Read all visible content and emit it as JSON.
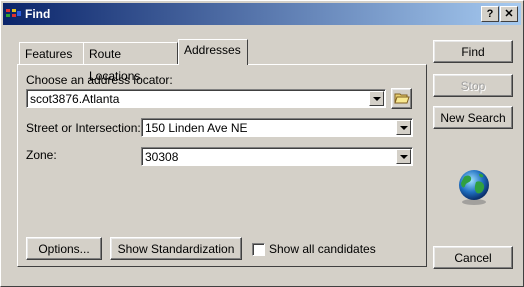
{
  "window": {
    "title": "Find",
    "help_label": "?",
    "close_label": "✕"
  },
  "tabs": [
    {
      "label": "Features"
    },
    {
      "label": "Route Locations"
    },
    {
      "label": "Addresses"
    }
  ],
  "address_locator": {
    "label": "Choose an address locator:",
    "value": "scot3876.Atlanta"
  },
  "street": {
    "label": "Street or Intersection:",
    "value": "150 Linden Ave NE"
  },
  "zone": {
    "label": "Zone:",
    "value": "30308"
  },
  "buttons": {
    "find": "Find",
    "stop": "Stop",
    "new_search": "New Search",
    "cancel": "Cancel",
    "options": "Options...",
    "show_standardization": "Show Standardization"
  },
  "show_all_candidates": {
    "label": "Show all candidates",
    "checked": false
  },
  "icons": {
    "title": "find-app-icon",
    "folder": "open-folder-icon",
    "globe": "globe-icon"
  },
  "colors": {
    "titlebar_start": "#0a246a",
    "titlebar_end": "#a6caf0",
    "face": "#d4d0c8"
  }
}
